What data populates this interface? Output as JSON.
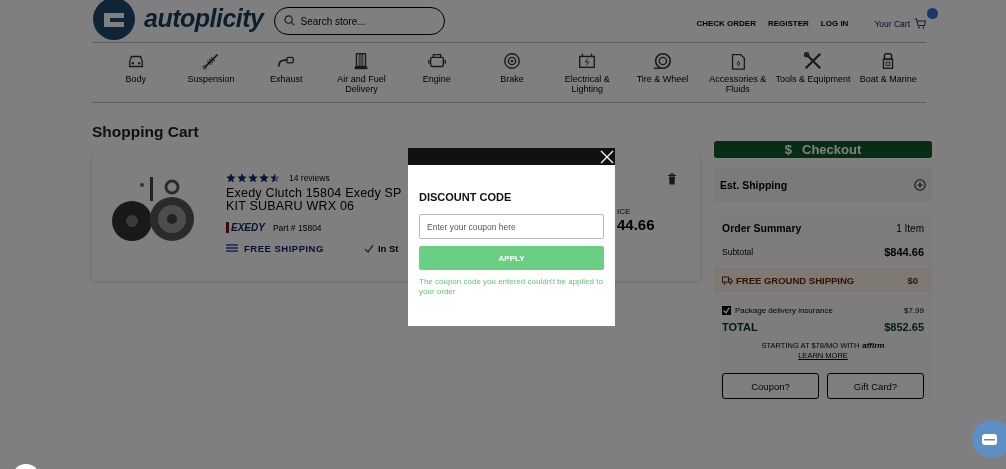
{
  "header": {
    "logo": "autoplicity",
    "search": {
      "placeholder": "Search store..."
    },
    "links": [
      "CHECK ORDER",
      "REGISTER",
      "LOG IN"
    ],
    "cart": {
      "label": "Your Cart"
    }
  },
  "categories": [
    {
      "label": "Body"
    },
    {
      "label": "Suspension"
    },
    {
      "label": "Exhaust"
    },
    {
      "label": "Air and Fuel Delivery"
    },
    {
      "label": "Engine"
    },
    {
      "label": "Brake"
    },
    {
      "label": "Electrical & Lighting"
    },
    {
      "label": "Tire & Wheel"
    },
    {
      "label": "Accessories & Fluids"
    },
    {
      "label": "Tools & Equipment"
    },
    {
      "label": "Boat & Marine"
    }
  ],
  "page_title": "Shopping Cart",
  "cart_item": {
    "stars": 4.5,
    "reviews": "14 reviews",
    "title_lines": [
      "Exedy Clutch 15804 Exedy SP",
      "KIT SUBARU WRX 06"
    ],
    "brand_logo": "EXEDY",
    "part": "Part # 15804",
    "shipping": "FREE SHIPPING",
    "stock": "In St",
    "price_label": "ICE",
    "price": "44.66"
  },
  "summary": {
    "checkout_icon": "$",
    "checkout": "Checkout",
    "est_shipping": "Est. Shipping",
    "title": "Order Summary",
    "count": "1 Item",
    "subtotal": {
      "label": "Subtotal",
      "value": "$844.66"
    },
    "free_shipping": {
      "label": "FREE GROUND SHIPPING",
      "value": "$0"
    },
    "insurance": {
      "label": "Package delivery insurance",
      "value": "$7.99",
      "checked": true
    },
    "total": {
      "label": "TOTAL",
      "value": "$852.65"
    },
    "affirm": {
      "text": "STARTING AT $78/MO WITH",
      "logo": "affirm",
      "link": "LEARN MORE"
    },
    "buttons": [
      "Coupon?",
      "Gift Card?"
    ]
  },
  "modal": {
    "title": "DISCOUNT CODE",
    "placeholder": "Enter your coupon here",
    "apply": "APPLY",
    "error": "The coupon code you entered couldn't be applied to your order"
  }
}
